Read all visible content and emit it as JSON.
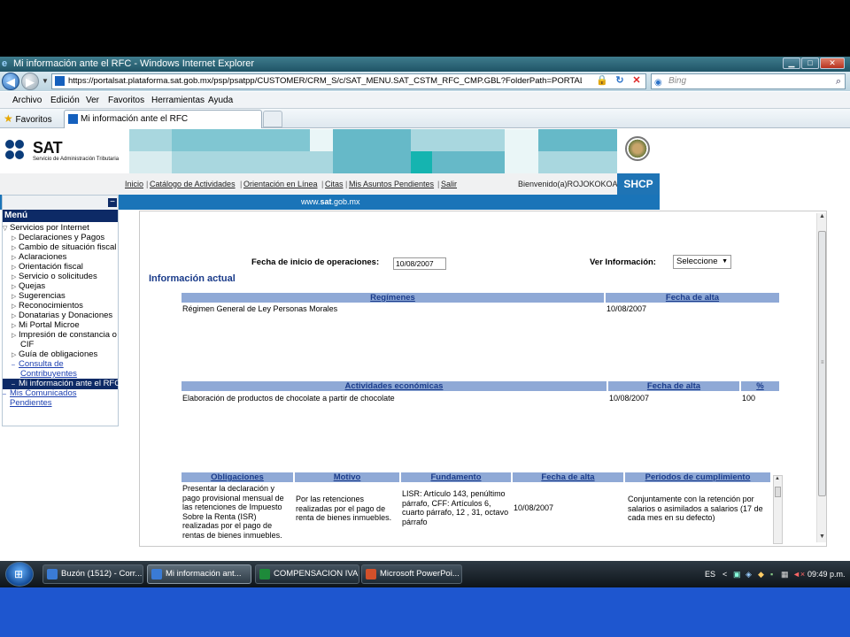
{
  "window": {
    "title": "Mi información ante el RFC - Windows Internet Explorer"
  },
  "browser": {
    "address": "https://portalsat.plataforma.sat.gob.mx/psp/psatpp/CUSTOMER/CRM_S/c/SAT_MENU.SAT_CSTM_RFC_CMP.GBL?FolderPath=PORTAL_ROOT_OE",
    "search_placeholder": "Bing",
    "menu": [
      "Archivo",
      "Edición",
      "Ver",
      "Favoritos",
      "Herramientas",
      "Ayuda"
    ],
    "favorites_label": "Favoritos",
    "tab_label": "Mi información ante el RFC"
  },
  "sat": {
    "logo_text": "SAT",
    "logo_sub": "Servicio de Administración Tributaria",
    "nav": [
      "Inicio",
      "Catálogo de Actividades",
      "Orientación en Línea",
      "Citas",
      "Mis Asuntos Pendientes",
      "Salir"
    ],
    "welcome": "Bienvenido(a)ROJOKOKOA",
    "shcp": "SHCP",
    "site_url_prefix": "www.",
    "site_url_bold": "sat",
    "site_url_suffix": ".gob.mx"
  },
  "left_menu": {
    "header": "Menú",
    "root": "Servicios por Internet",
    "items": [
      "Declaraciones y Pagos",
      "Cambio de situación fiscal",
      "Aclaraciones",
      "Orientación fiscal",
      "Servicio o solicitudes",
      "Quejas",
      "Sugerencias",
      "Reconocimientos",
      "Donatarias y Donaciones",
      "Mi Portal Microe",
      "Impresión de constancia o",
      "CIF",
      "Guía de obligaciones",
      "Consulta de",
      "Contribuyentes",
      "Mi información ante el RFC",
      "Mis Comunicados",
      "Pendientes"
    ]
  },
  "form": {
    "fecha_label": "Fecha de inicio de operaciones:",
    "fecha_value": "10/08/2007",
    "ver_label": "Ver Información:",
    "ver_value": "Seleccione",
    "section_title": "Información actual"
  },
  "regimenes": {
    "headers": [
      "Regímenes",
      "Fecha de alta"
    ],
    "rows": [
      [
        "Régimen General de Ley Personas Morales",
        "10/08/2007"
      ]
    ]
  },
  "actividades": {
    "headers": [
      "Actividades económicas",
      "Fecha de alta",
      "%"
    ],
    "rows": [
      [
        "Elaboración de productos de chocolate a partir de chocolate",
        "10/08/2007",
        "100"
      ]
    ]
  },
  "obligaciones": {
    "headers": [
      "Obligaciones",
      "Motivo",
      "Fundamento",
      "Fecha de alta",
      "Periodos de cumplimiento"
    ],
    "rows": [
      [
        "Presentar la declaración y pago provisional mensual de las retenciones de Impuesto Sobre la Renta (ISR) realizadas por el pago de rentas de bienes inmuebles.",
        "Por las retenciones realizadas por el pago de renta de bienes inmuebles.",
        "LISR: Artículo 143, penúltimo párrafo, CFF: Artículos 6, cuarto párrafo, 12 , 31, octavo párrafo",
        "10/08/2007",
        "Conjuntamente con la retención por salarios o asimilados a salarios (17 de cada mes en su defecto)"
      ]
    ]
  },
  "taskbar": {
    "items": [
      "Buzón (1512) - Corr...",
      "Mi información ant...",
      "COMPENSACION IVA",
      "Microsoft PowerPoi..."
    ],
    "lang": "ES",
    "clock": "09:49 p.m."
  },
  "colors": {
    "sat_blue": "#1a74b8",
    "menu_navy": "#0d2a66",
    "table_header": "#8fa9d6"
  }
}
